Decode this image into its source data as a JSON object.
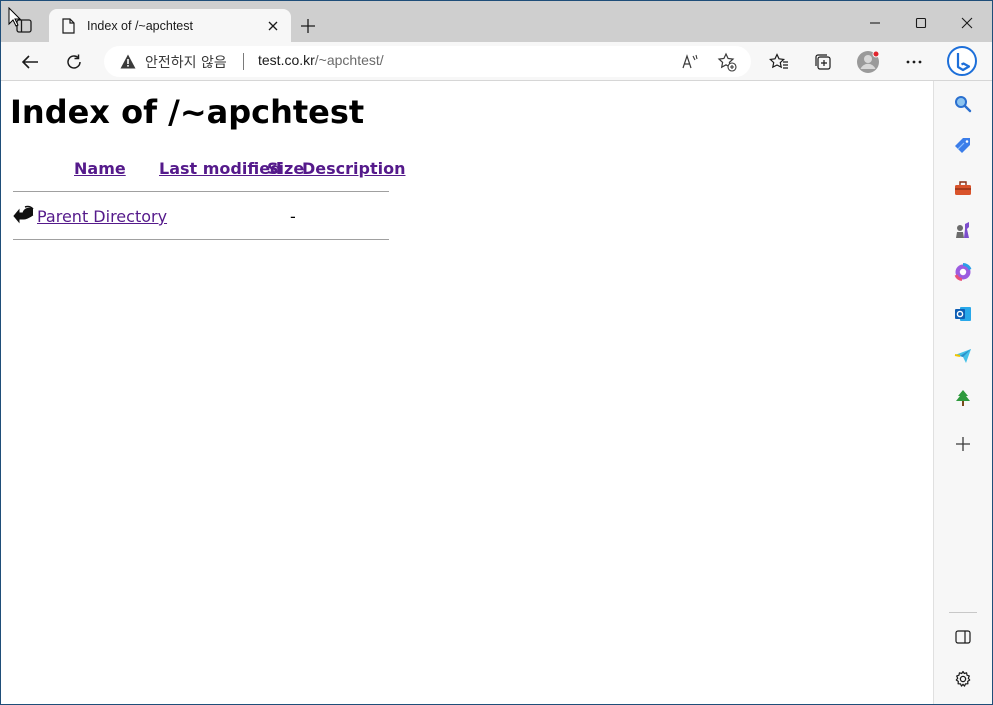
{
  "tab": {
    "title": "Index of /~apchtest"
  },
  "addressbar": {
    "security_label": "안전하지 않음",
    "url_host": "test.co.kr",
    "url_path": "/~apchtest/"
  },
  "page": {
    "heading": "Index of /~apchtest",
    "columns": {
      "name": "Name",
      "last_modified": "Last modified",
      "size": "Size",
      "description": "Description"
    },
    "rows": [
      {
        "name": "Parent Directory",
        "last_modified": "",
        "size": "-",
        "description": ""
      }
    ]
  },
  "icons": {
    "tab_actions": "tab-actions-icon",
    "page": "page-icon",
    "close": "close-icon",
    "new_tab": "plus-icon",
    "minimize": "minimize-icon",
    "maximize": "maximize-icon",
    "close_window": "close-window-icon",
    "back": "back-arrow-icon",
    "refresh": "refresh-icon",
    "warning": "warning-icon",
    "read_aloud": "read-aloud-icon",
    "add_favorite": "add-favorite-icon",
    "favorites": "favorites-icon",
    "collections": "collections-icon",
    "profile": "profile-icon",
    "more": "more-icon",
    "bing": "bing-icon",
    "search": "search-icon",
    "shopping": "shopping-tag-icon",
    "tools": "toolbox-icon",
    "games": "games-icon",
    "office": "office-icon",
    "outlook": "outlook-icon",
    "send": "send-icon",
    "tree": "tree-icon",
    "add": "add-icon",
    "sidebar_toggle": "sidebar-toggle-icon",
    "settings": "settings-gear-icon",
    "parent_dir": "back-folder-icon"
  },
  "colors": {
    "link": "#551a8b",
    "tabstrip": "#cfcfcf",
    "toolbar": "#f7f7f7",
    "bing_blue": "#1d6fd9"
  }
}
